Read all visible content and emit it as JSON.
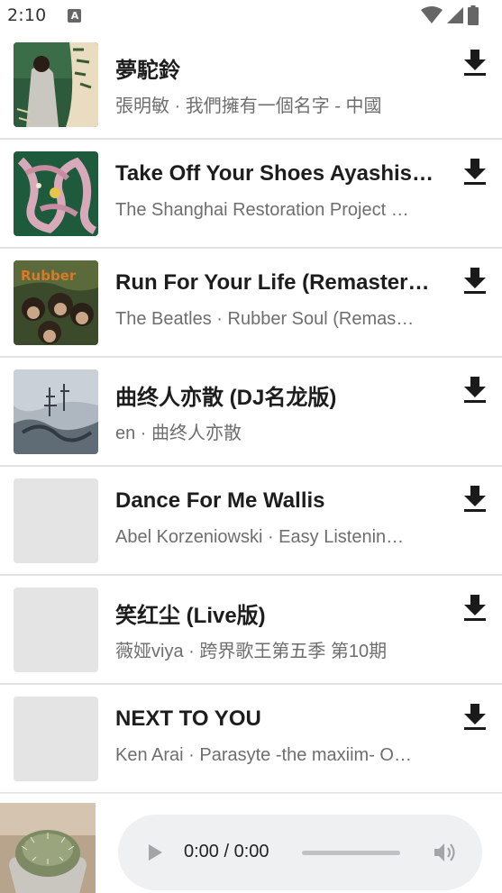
{
  "status_bar": {
    "time": "2:10",
    "notification_icon": "a-icon",
    "wifi_icon": "wifi-icon",
    "signal_icon": "signal-icon",
    "battery_icon": "battery-icon"
  },
  "songs": [
    {
      "title": "夢駝鈴",
      "subtitle": "張明敏 · 我們擁有一個名字 - 中國",
      "cover": "album-cover-art",
      "download_icon": "download-icon"
    },
    {
      "title": "Take Off Your Shoes Ayashis…",
      "subtitle": "The Shanghai Restoration Project …",
      "cover": "album-cover-art",
      "download_icon": "download-icon"
    },
    {
      "title": "Run For Your Life (Remastere…",
      "subtitle": "The Beatles · Rubber Soul (Remas…",
      "cover": "album-cover-art",
      "download_icon": "download-icon"
    },
    {
      "title": "曲终人亦散 (DJ名龙版)",
      "subtitle": "en · 曲终人亦散",
      "cover": "album-cover-art",
      "download_icon": "download-icon"
    },
    {
      "title": "Dance For Me Wallis",
      "subtitle": "Abel Korzeniowski · Easy Listenin…",
      "cover": "album-cover-placeholder",
      "download_icon": "download-icon"
    },
    {
      "title": "笑红尘 (Live版)",
      "subtitle": "薇娅viya · 跨界歌王第五季 第10期",
      "cover": "album-cover-placeholder",
      "download_icon": "download-icon"
    },
    {
      "title": "NEXT TO YOU",
      "subtitle": "Ken Arai · Parasyte -the maxiim- O…",
      "cover": "album-cover-placeholder",
      "download_icon": "download-icon"
    }
  ],
  "player": {
    "thumbnail": "cactus-thumbnail",
    "time_display": "0:00 / 0:00",
    "progress": 0,
    "play_icon": "play-icon",
    "volume_icon": "volume-icon"
  },
  "colors": {
    "divider": "#e2e2e2",
    "title_text": "#1d1d1d",
    "subtitle_text": "#6e6e6e",
    "icon": "#1a1a1a",
    "player_pill": "#eef0f2",
    "placeholder": "#e4e4e4"
  }
}
